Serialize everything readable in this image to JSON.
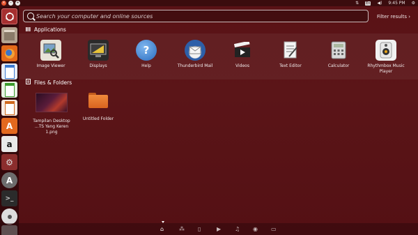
{
  "top_panel": {
    "clock": "9:45 PM",
    "keyboard_layout": "En"
  },
  "search": {
    "placeholder": "Search your computer and online sources",
    "value": "",
    "filter_label": "Filter results"
  },
  "sections": {
    "applications": "Applications",
    "files": "Files & Folders"
  },
  "apps": [
    {
      "label": "Image Viewer",
      "icon": "image-viewer-icon"
    },
    {
      "label": "Displays",
      "icon": "displays-icon"
    },
    {
      "label": "Help",
      "icon": "help-icon"
    },
    {
      "label": "Thunderbird Mail",
      "icon": "thunderbird-icon"
    },
    {
      "label": "Videos",
      "icon": "videos-icon"
    },
    {
      "label": "Text Editor",
      "icon": "text-editor-icon"
    },
    {
      "label": "Calculator",
      "icon": "calculator-icon"
    },
    {
      "label": "Rhythmbox Music Player",
      "icon": "rhythmbox-icon"
    }
  ],
  "files": [
    {
      "label_line1": "Tampilan Desktop",
      "label_line2": "...TS Yang Keren 1.png",
      "icon": "image-file-thumbnail"
    },
    {
      "label": "Untitled Folder",
      "icon": "folder-icon"
    }
  ],
  "launcher": [
    "dash-home-icon",
    "files-icon",
    "firefox-icon",
    "writer-icon",
    "calc-icon",
    "impress-icon",
    "software-center-icon",
    "amazon-icon",
    "settings-icon",
    "updater-icon",
    "terminal-icon",
    "dvd-icon",
    "trash-icon"
  ],
  "lenses": [
    "home-lens-icon",
    "applications-lens-icon",
    "files-lens-icon",
    "video-lens-icon",
    "music-lens-icon",
    "photos-lens-icon",
    "social-lens-icon"
  ]
}
